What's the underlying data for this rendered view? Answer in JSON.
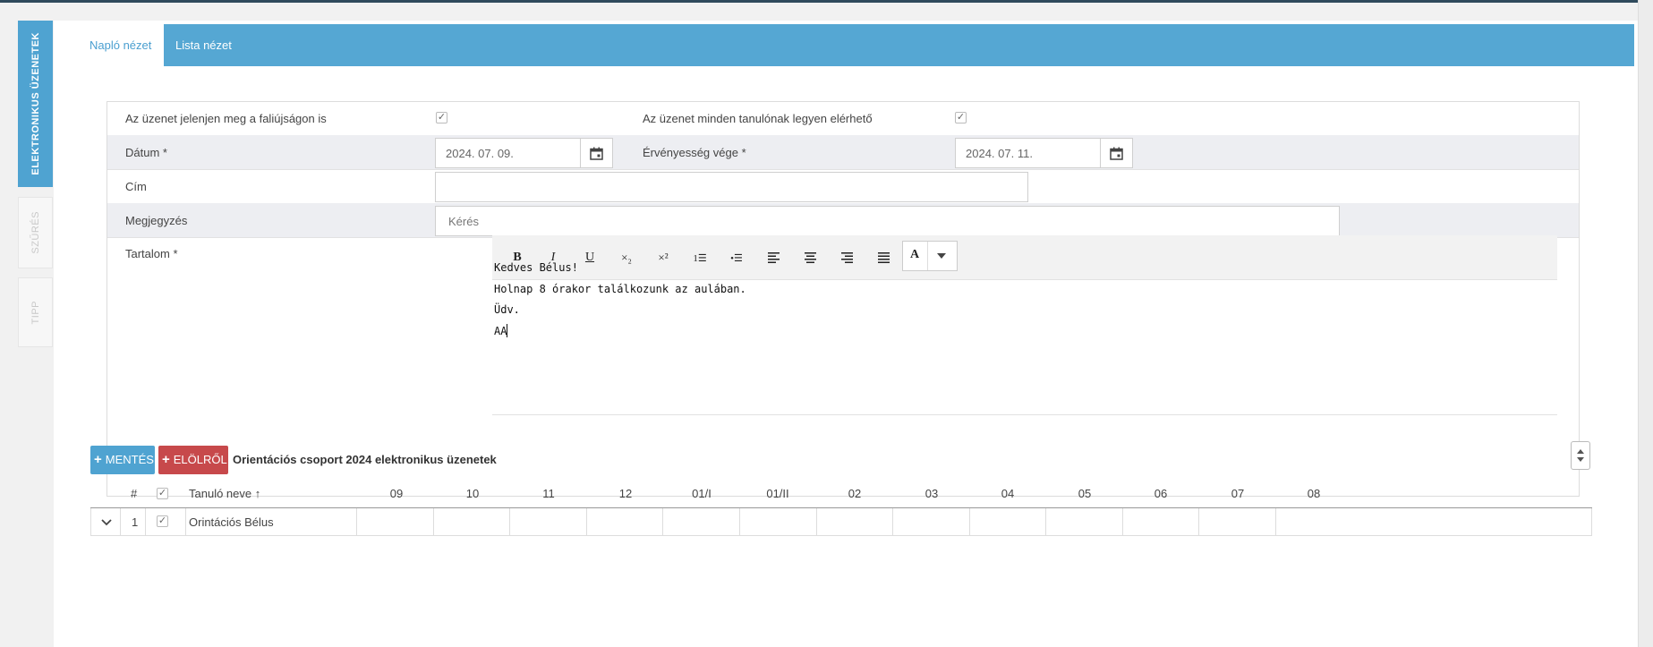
{
  "sidebar": {
    "tabs": [
      {
        "label": "ELEKTRONIKUS ÜZENETEK"
      },
      {
        "label": "SZŰRÉS"
      },
      {
        "label": "TIPP"
      }
    ]
  },
  "view_tabs": [
    {
      "label": "Napló nézet"
    },
    {
      "label": "Lista nézet"
    }
  ],
  "form": {
    "wall_label": "Az üzenet jelenjen meg a faliújságon is",
    "wall_checked": true,
    "all_students_label": "Az üzenet minden tanulónak legyen elérhető",
    "all_students_checked": true,
    "date_label": "Dátum *",
    "date_value": "2024. 07. 09.",
    "validity_label": "Érvényesség vége *",
    "validity_value": "2024. 07. 11.",
    "title_label": "Cím",
    "title_value": "",
    "note_label": "Megjegyzés",
    "note_placeholder": "Kérés",
    "content_label": "Tartalom *"
  },
  "editor": {
    "toolbar": [
      {
        "label": "B",
        "name": "bold-button"
      },
      {
        "label": "I",
        "name": "italic-button"
      },
      {
        "label": "U",
        "name": "underline-button"
      },
      {
        "label": "×₂",
        "name": "subscript-button"
      },
      {
        "label": "×²",
        "name": "superscript-button"
      },
      {
        "label": "1☰",
        "name": "ordered-list-button"
      },
      {
        "label": "•☰",
        "name": "unordered-list-button"
      },
      {
        "label": "",
        "name": "align-left-button"
      },
      {
        "label": "",
        "name": "align-center-button"
      },
      {
        "label": "",
        "name": "align-right-button"
      },
      {
        "label": "",
        "name": "align-justify-button"
      }
    ],
    "color_label": "A",
    "lines": [
      "Kedves Bélus!",
      "Holnap 8 órakor találkozunk az aulában.",
      "Üdv.",
      "AA"
    ]
  },
  "actions": {
    "save_label": "MENTÉS",
    "reset_label": "ELÖLRŐL",
    "group_title": "Orientációs csoport 2024 elektronikus üzenetek"
  },
  "table": {
    "headers": {
      "number": "#",
      "name": "Tanuló neve",
      "columns": [
        "09",
        "10",
        "11",
        "12",
        "01/I",
        "01/II",
        "02",
        "03",
        "04",
        "05",
        "06",
        "07",
        "08"
      ]
    },
    "rows": [
      {
        "number": "1",
        "checked": true,
        "name": "Orintációs Bélus"
      }
    ]
  },
  "colors": {
    "accent": "#55a7d3",
    "danger": "#c7494b",
    "row_alt": "#edeef2"
  }
}
